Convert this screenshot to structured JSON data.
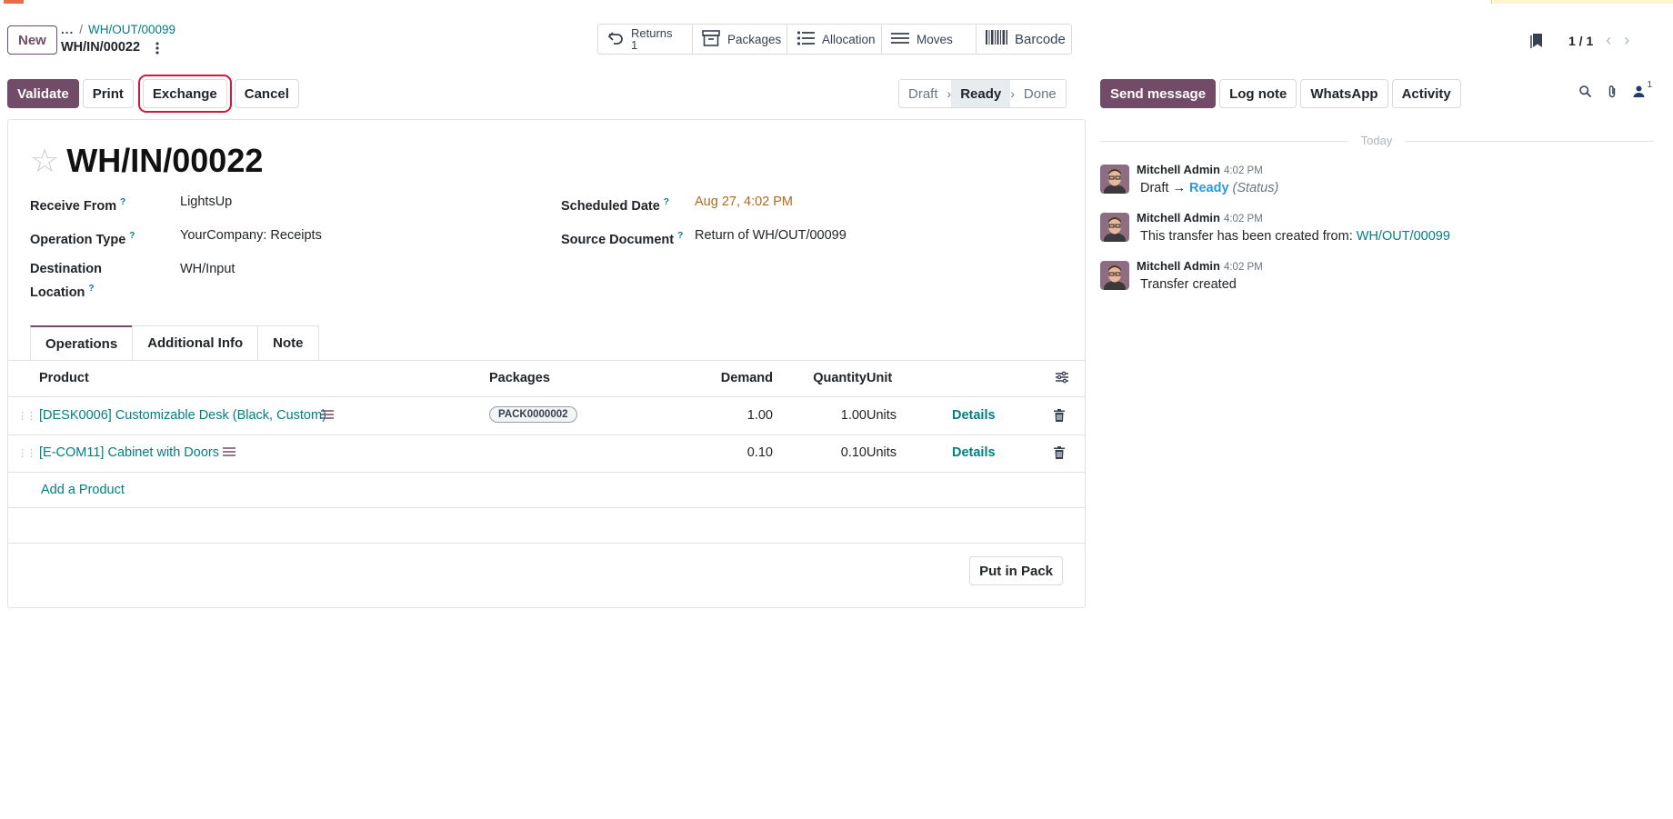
{
  "colors": {
    "brand": "#714b67",
    "link": "#017e84",
    "warning_date": "#b06a1c",
    "highlight_outline": "#d4193f",
    "status_ready": "#2a9bd8"
  },
  "control_panel": {
    "new_label": "New",
    "breadcrumb": {
      "ellipsis": "...",
      "separator": "/",
      "parent": "WH/OUT/00099",
      "current": "WH/IN/00022"
    },
    "smart_buttons": [
      {
        "label": "Returns",
        "count": "1",
        "icon": "undo-icon"
      },
      {
        "label": "Packages",
        "icon": "box-icon"
      },
      {
        "label": "Allocation",
        "icon": "list-icon"
      },
      {
        "label": "Moves",
        "icon": "bars-icon"
      },
      {
        "label": "Barcode",
        "icon": "barcode-icon"
      }
    ],
    "pager": {
      "value": "1 / 1"
    }
  },
  "actions": {
    "validate": "Validate",
    "print": "Print",
    "exchange": "Exchange",
    "cancel": "Cancel"
  },
  "statusbar": {
    "draft": "Draft",
    "ready": "Ready",
    "done": "Done",
    "active": "Ready"
  },
  "form": {
    "title": "WH/IN/00022",
    "help_mark": "?",
    "fields": {
      "receive_from": {
        "label": "Receive From",
        "value": "LightsUp"
      },
      "operation_type": {
        "label": "Operation Type",
        "value": "YourCompany: Receipts"
      },
      "destination_location": {
        "label": "Destination Location",
        "value": "WH/Input"
      },
      "scheduled_date": {
        "label": "Scheduled Date",
        "value": "Aug 27, 4:02 PM"
      },
      "source_document": {
        "label": "Source Document",
        "value": "Return of WH/OUT/00099"
      }
    },
    "tabs": [
      "Operations",
      "Additional Info",
      "Note"
    ],
    "table": {
      "headers": {
        "product": "Product",
        "packages": "Packages",
        "demand": "Demand",
        "quantity": "Quantity",
        "unit": "Unit"
      },
      "rows": [
        {
          "product": "[DESK0006] Customizable Desk (Black, Custom)",
          "package": "PACK0000002",
          "demand": "1.00",
          "quantity": "1.00",
          "unit": "Units",
          "details": "Details"
        },
        {
          "product": "[E-COM11] Cabinet with Doors",
          "package": "",
          "demand": "0.10",
          "quantity": "0.10",
          "unit": "Units",
          "details": "Details"
        }
      ],
      "add_product": "Add a Product"
    },
    "put_in_pack": "Put in Pack"
  },
  "chatter": {
    "buttons": {
      "send_message": "Send message",
      "log_note": "Log note",
      "whatsapp": "WhatsApp",
      "activity": "Activity"
    },
    "follower_count": "1",
    "date_separator": "Today",
    "messages": [
      {
        "author": "Mitchell Admin",
        "time": "4:02 PM",
        "from": "Draft",
        "arrow": "→",
        "to": "Ready",
        "field": "(Status)"
      },
      {
        "author": "Mitchell Admin",
        "time": "4:02 PM",
        "text": "This transfer has been created from:",
        "link": "WH/OUT/00099"
      },
      {
        "author": "Mitchell Admin",
        "time": "4:02 PM",
        "text": "Transfer created"
      }
    ]
  }
}
